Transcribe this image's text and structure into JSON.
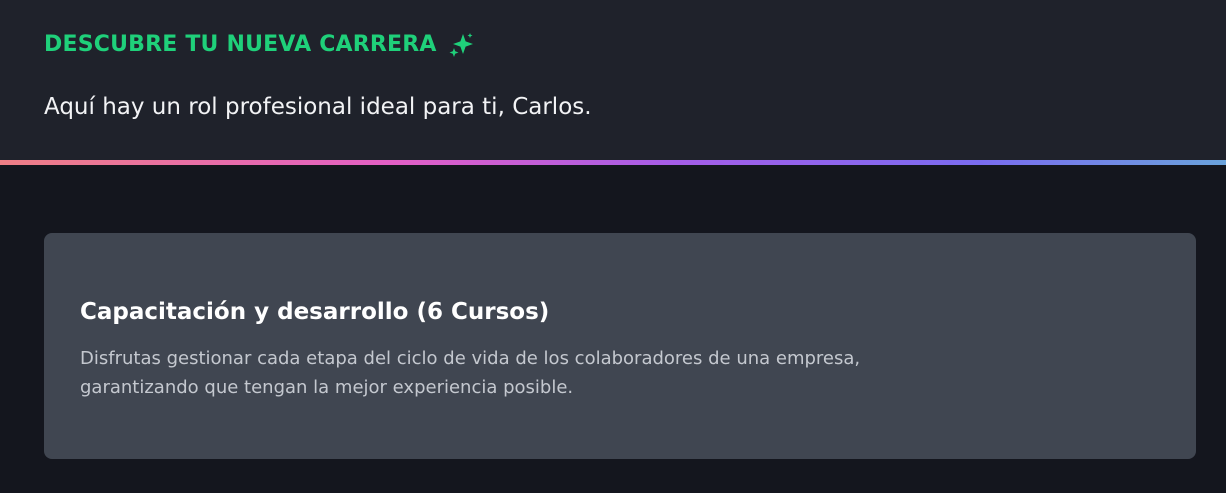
{
  "header": {
    "eyebrow": "DESCUBRE TU NUEVA CARRERA",
    "eyebrow_icon": "sparkle-icon",
    "greeting": "Aquí hay un rol profesional ideal para ti, Carlos."
  },
  "colors": {
    "accent_green": "#1fd07a",
    "header_bg": "#1f222b",
    "page_bg": "#14161e",
    "card_bg": "#404651",
    "gradient": [
      "#ef7f86",
      "#e35fc6",
      "#a55de8",
      "#7a6cf0",
      "#6aa3dc"
    ]
  },
  "card": {
    "title": "Capacitación y desarrollo (6 Cursos)",
    "description_line1": "Disfrutas gestionar cada etapa del ciclo de vida de los colaboradores de una empresa,",
    "description_line2": "garantizando que tengan la mejor experiencia posible."
  }
}
